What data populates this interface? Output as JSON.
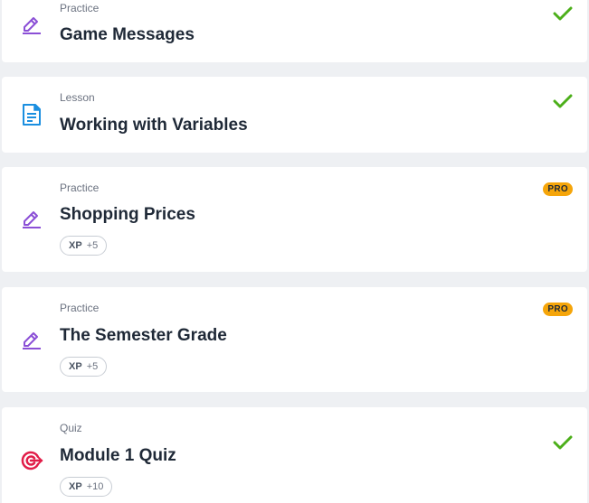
{
  "items": [
    {
      "type": "Practice",
      "title": "Game Messages",
      "icon": "pencil-practice-icon",
      "status": "completed-check"
    },
    {
      "type": "Lesson",
      "title": "Working with Variables",
      "icon": "document-lesson-icon",
      "status": "completed-check"
    },
    {
      "type": "Practice",
      "title": "Shopping Prices",
      "icon": "pencil-practice-icon",
      "badge": "PRO",
      "xp_label": "XP",
      "xp_value": "+5"
    },
    {
      "type": "Practice",
      "title": "The Semester Grade",
      "icon": "pencil-practice-icon",
      "badge": "PRO",
      "xp_label": "XP",
      "xp_value": "+5"
    },
    {
      "type": "Quiz",
      "title": "Module 1 Quiz",
      "icon": "target-quiz-icon",
      "status": "completed-check",
      "xp_label": "XP",
      "xp_value": "+10"
    }
  ],
  "colors": {
    "practice_icon": "#8b4fd6",
    "lesson_icon": "#1b8fe0",
    "quiz_icon": "#e11d48",
    "check": "#4caf1a",
    "pro_badge": "#f5a50a"
  }
}
